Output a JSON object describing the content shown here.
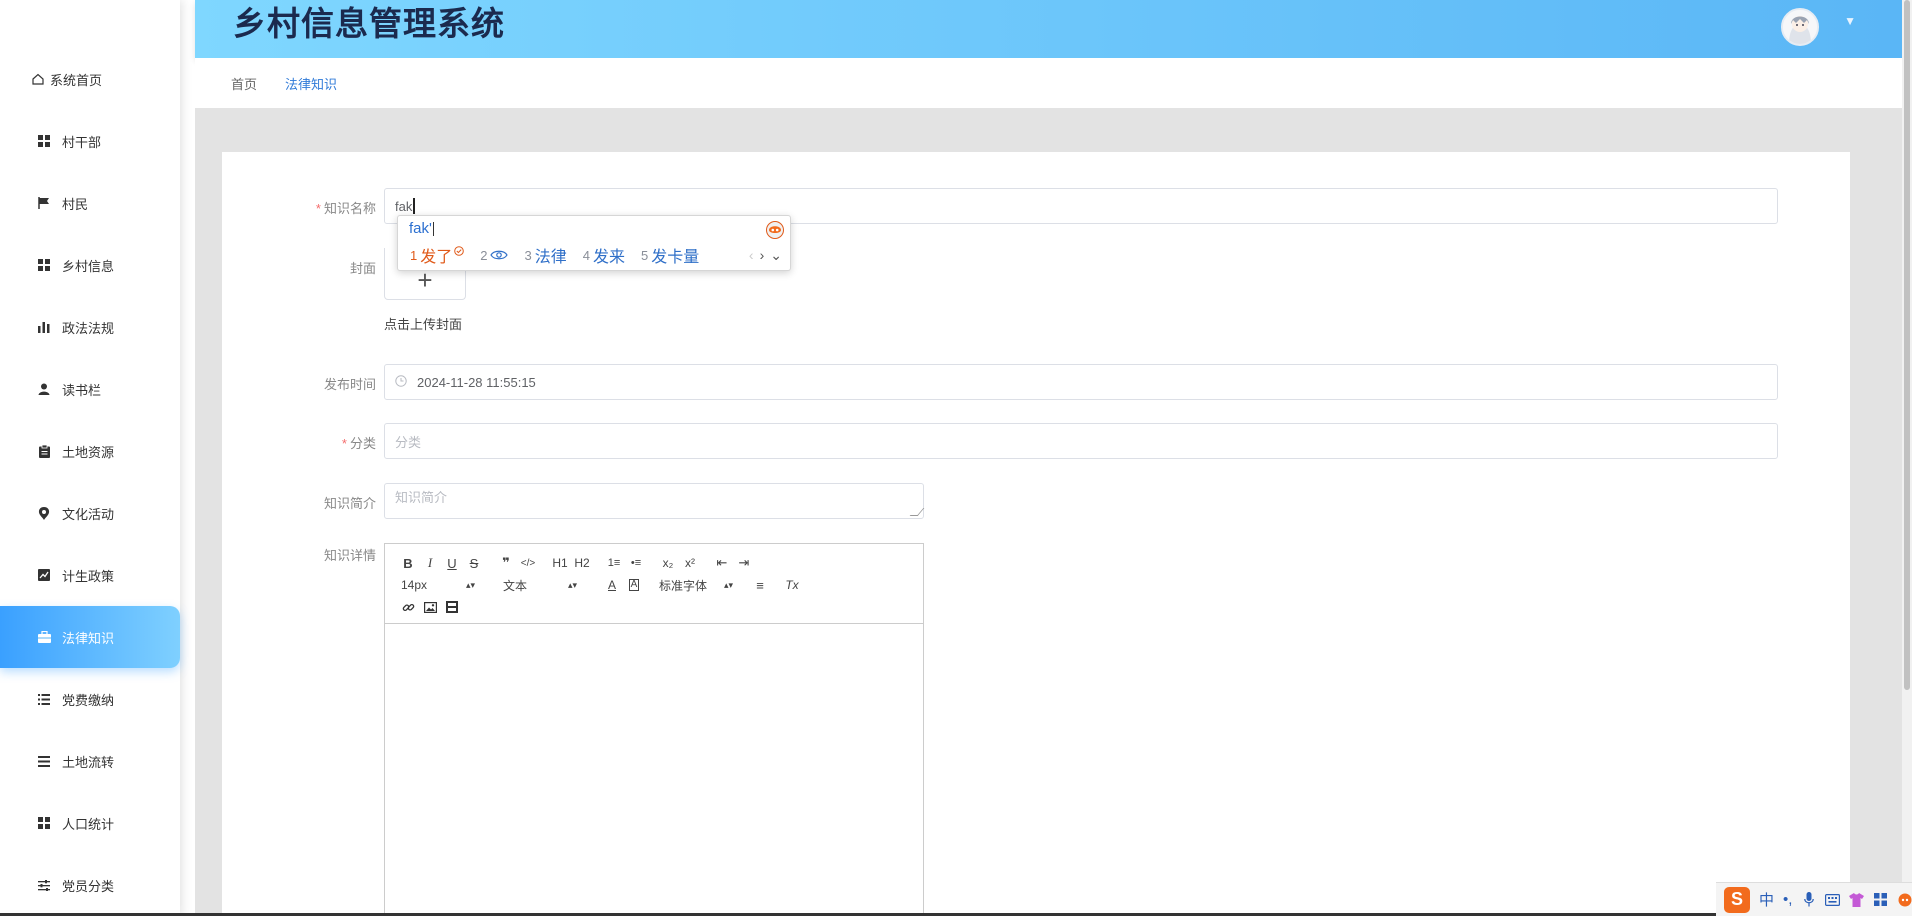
{
  "header": {
    "title": "乡村信息管理系统"
  },
  "sidebar": {
    "items": [
      {
        "label": "系统首页",
        "icon": "home-icon",
        "active": false
      },
      {
        "label": "村干部",
        "icon": "grid-icon",
        "active": false
      },
      {
        "label": "村民",
        "icon": "flag-icon",
        "active": false
      },
      {
        "label": "乡村信息",
        "icon": "grid-icon",
        "active": false
      },
      {
        "label": "政法法规",
        "icon": "bar-chart-icon",
        "active": false
      },
      {
        "label": "读书栏",
        "icon": "user-icon",
        "active": false
      },
      {
        "label": "土地资源",
        "icon": "clipboard-icon",
        "active": false
      },
      {
        "label": "文化活动",
        "icon": "location-pin-icon",
        "active": false
      },
      {
        "label": "计生政策",
        "icon": "line-chart-icon",
        "active": false
      },
      {
        "label": "法律知识",
        "icon": "briefcase-icon",
        "active": true
      },
      {
        "label": "党费缴纳",
        "icon": "list-icon",
        "active": false
      },
      {
        "label": "土地流转",
        "icon": "menu-lines-icon",
        "active": false
      },
      {
        "label": "人口统计",
        "icon": "grid-icon",
        "active": false
      },
      {
        "label": "党员分类",
        "icon": "sliders-icon",
        "active": false
      }
    ]
  },
  "breadcrumb": {
    "home": "首页",
    "current": "法律知识"
  },
  "form": {
    "name": {
      "label": "知识名称",
      "value": "fak"
    },
    "cover": {
      "label": "封面",
      "plus": "+",
      "hint": "点击上传封面"
    },
    "publish_time": {
      "label": "发布时间",
      "value": "2024-11-28 11:55:15"
    },
    "category": {
      "label": "分类",
      "placeholder": "分类"
    },
    "intro": {
      "label": "知识简介",
      "placeholder": "知识简介"
    },
    "detail": {
      "label": "知识详情"
    },
    "required_mark": "*"
  },
  "editor": {
    "bold": "B",
    "italic": "I",
    "underline": "U",
    "strike": "S",
    "quote": "❞",
    "code": "</>",
    "h1": "H1",
    "h2": "H2",
    "ordered_list": "1≡",
    "bullet_list": "•≡",
    "subscript": "x₂",
    "superscript": "x²",
    "outdent": "⇤",
    "indent": "⇥",
    "font_size": "14px",
    "block_type": "文本",
    "font_family": "标准字体",
    "font_color": "A",
    "bg_color": "A",
    "align": "≡",
    "clean": "Tx",
    "link_icon": "link-icon",
    "image_icon": "image-icon",
    "video_icon": "video-icon"
  },
  "ime": {
    "composition": "fak'",
    "candidates": [
      {
        "n": "1",
        "text": "发了"
      },
      {
        "n": "2",
        "text": ""
      },
      {
        "n": "3",
        "text": "法律"
      },
      {
        "n": "4",
        "text": "发来"
      },
      {
        "n": "5",
        "text": "发卡量"
      }
    ],
    "nav_prev": "‹",
    "nav_next": "›",
    "nav_more": "⌄"
  },
  "tray": {
    "logo": "S",
    "mode": "中",
    "punct": "•,"
  },
  "colors": {
    "accent": "#3aa0ff",
    "header_start": "#7fd7ff",
    "header_end": "#5ab6f6",
    "title": "#1b2a4e",
    "ime_orange": "#f26b1d"
  }
}
